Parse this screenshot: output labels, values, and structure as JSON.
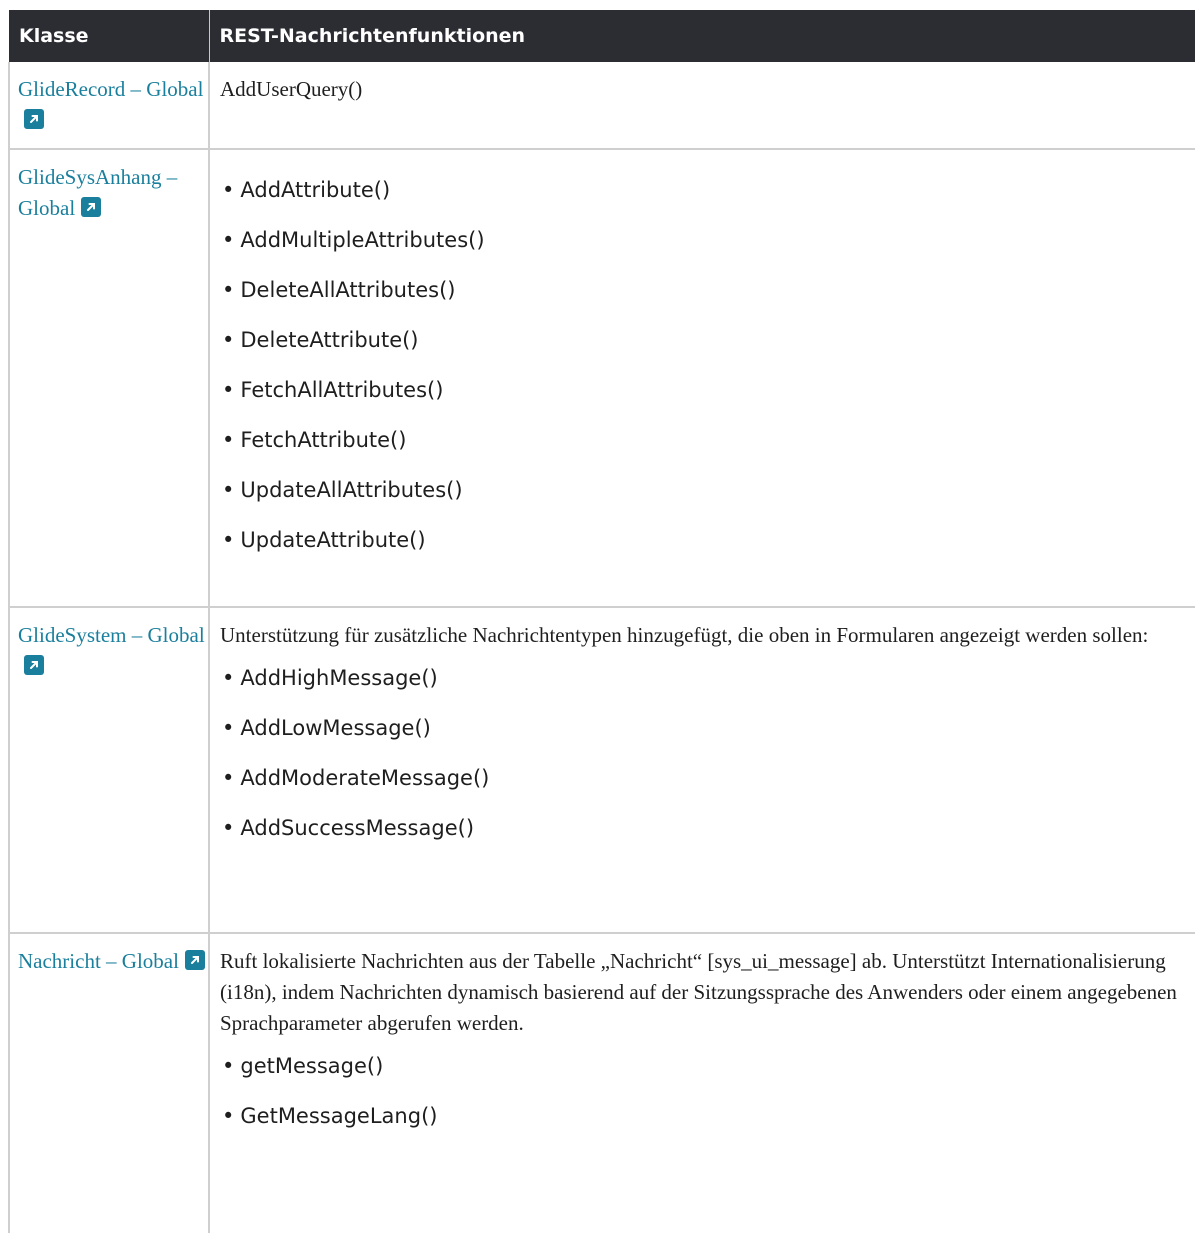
{
  "header": {
    "col1": "Klasse",
    "col2": "REST-Nachrichtenfunktionen"
  },
  "rows": [
    {
      "class_name": "GlideRecord – Global",
      "description": "AddUserQuery()",
      "methods": []
    },
    {
      "class_name": "GlideSysAnhang – Global",
      "description": "",
      "methods": [
        "AddAttribute()",
        "AddMultipleAttributes()",
        "DeleteAllAttributes()",
        "DeleteAttribute()",
        "FetchAllAttributes()",
        "FetchAttribute()",
        "UpdateAllAttributes()",
        "UpdateAttribute()"
      ]
    },
    {
      "class_name": "GlideSystem – Global",
      "description": "Unterstützung für zusätzliche Nachrichtentypen hinzugefügt, die oben in Formularen angezeigt werden sollen:",
      "methods": [
        "AddHighMessage()",
        "AddLowMessage()",
        "AddModerateMessage()",
        "AddSuccessMessage()"
      ]
    },
    {
      "class_name": "Nachricht – Global",
      "description": "Ruft lokalisierte Nachrichten aus der Tabelle „Nachricht“ [sys_ui_message] ab. Unterstützt Internationalisierung (i18n), indem Nachrichten dynamisch basierend auf der Sitzungssprache des Anwenders oder einem angegebenen Sprachparameter abgerufen werden.",
      "methods": [
        "getMessage()",
        "GetMessageLang()"
      ]
    }
  ],
  "colors": {
    "header_bg": "#2b2d33",
    "link": "#1a7f9c"
  },
  "icons": {
    "external_link": "external-link-icon"
  }
}
